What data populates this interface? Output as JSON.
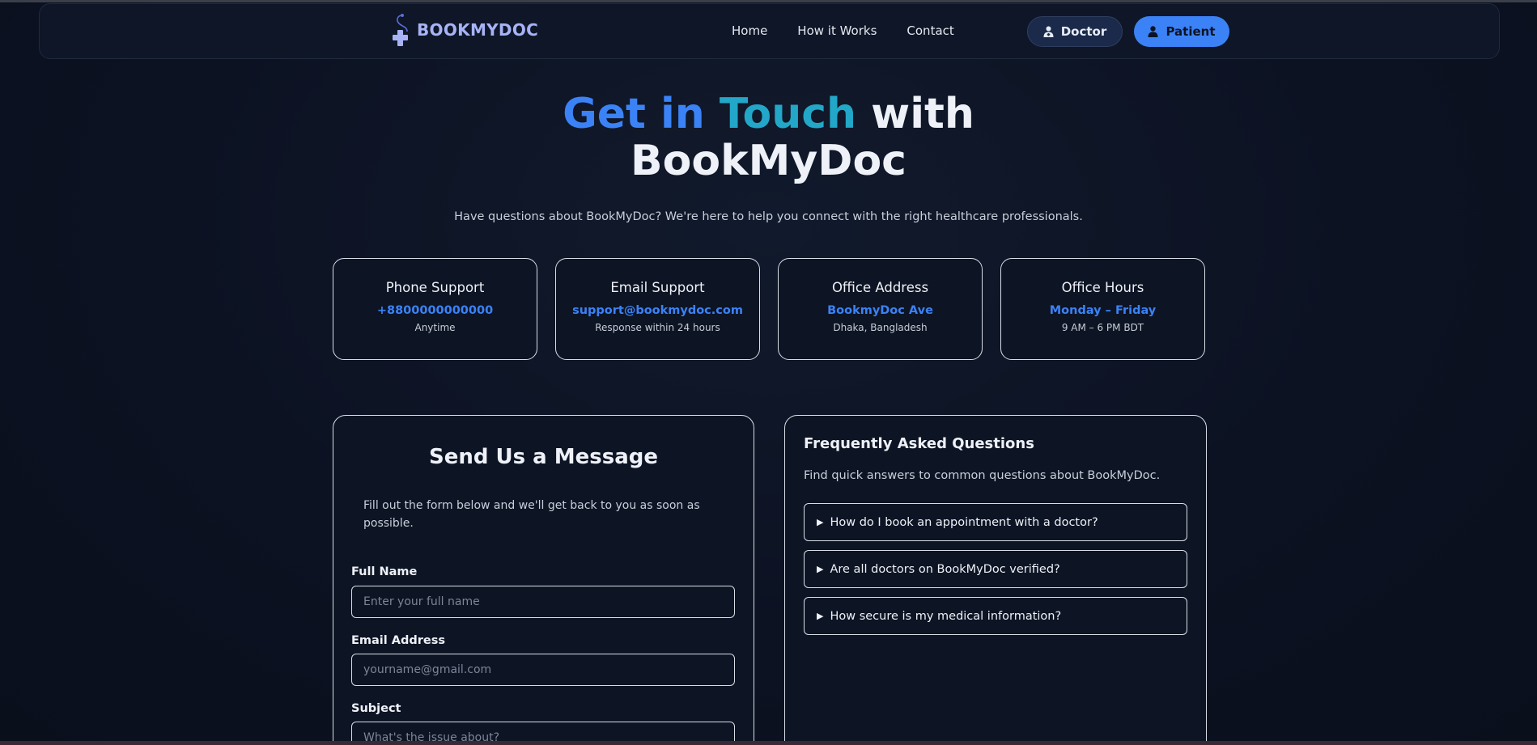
{
  "nav": {
    "brand": "BOOKMYDOC",
    "links": [
      "Home",
      "How it Works",
      "Contact"
    ],
    "doctor_label": "Doctor",
    "patient_label": "Patient"
  },
  "hero": {
    "title_part1": "Get in ",
    "title_part2": "Touch",
    "title_part3": " with",
    "title_line2": "BookMyDoc",
    "subtitle": "Have questions about BookMyDoc? We're here to help you connect with the right healthcare professionals."
  },
  "cards": [
    {
      "title": "Phone Support",
      "value": "+8800000000000",
      "note": "Anytime"
    },
    {
      "title": "Email Support",
      "value": "support@bookmydoc.com",
      "note": "Response within 24 hours"
    },
    {
      "title": "Office Address",
      "value": "BookmyDoc Ave",
      "note": "Dhaka, Bangladesh"
    },
    {
      "title": "Office Hours",
      "value": "Monday – Friday",
      "note": "9 AM – 6 PM BDT"
    }
  ],
  "form": {
    "title": "Send Us a Message",
    "description": "Fill out the form below and we'll get back to you as soon as possible.",
    "fields": [
      {
        "label": "Full Name",
        "placeholder": "Enter your full name"
      },
      {
        "label": "Email Address",
        "placeholder": "yourname@gmail.com"
      },
      {
        "label": "Subject",
        "placeholder": "What's the issue about?"
      }
    ]
  },
  "faq": {
    "title": "Frequently Asked Questions",
    "description": "Find quick answers to common questions about BookMyDoc.",
    "items": [
      "How do I book an appointment with a doctor?",
      "Are all doctors on BookMyDoc verified?",
      "How secure is my medical information?"
    ]
  },
  "colors": {
    "accent": "#3b82f6",
    "teal": "#22a7c8",
    "background": "#0c1222"
  },
  "icons": {
    "brand": "medical-cross-stethoscope-icon",
    "doctor": "doctor-icon",
    "patient": "user-icon",
    "faq_toggle": "triangle-right-icon"
  }
}
